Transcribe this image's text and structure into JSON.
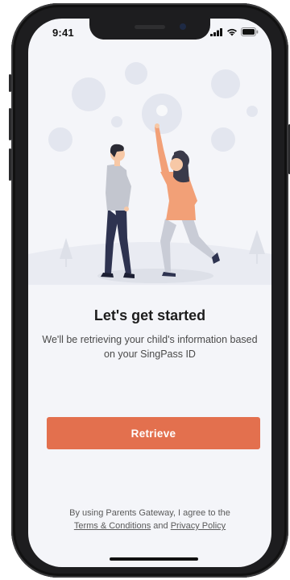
{
  "status_bar": {
    "time": "9:41",
    "icons": [
      "signal-icon",
      "wifi-icon",
      "battery-icon"
    ]
  },
  "illustration": {
    "name": "two-people-reaching-bubbles",
    "colors": {
      "bubble": "#e3e6ef",
      "ground": "#e9ebf2",
      "woman_top": "#f2a077",
      "woman_hair": "#3a3a4a",
      "woman_pants": "#c9ccd6",
      "man_top": "#c3c6cf",
      "man_pants": "#2e3350",
      "tree": "#dde0e8"
    }
  },
  "onboarding": {
    "title": "Let's get started",
    "subtitle": "We'll be retrieving your child's information based on your SingPass ID",
    "retrieve_label": "Retrieve"
  },
  "footer": {
    "prefix": "By using Parents Gateway, I agree to the",
    "terms_label": "Terms & Conditions",
    "and": "and",
    "privacy_label": "Privacy Policy"
  },
  "theme": {
    "accent": "#e3704e",
    "screen_bg": "#f4f5f9"
  }
}
